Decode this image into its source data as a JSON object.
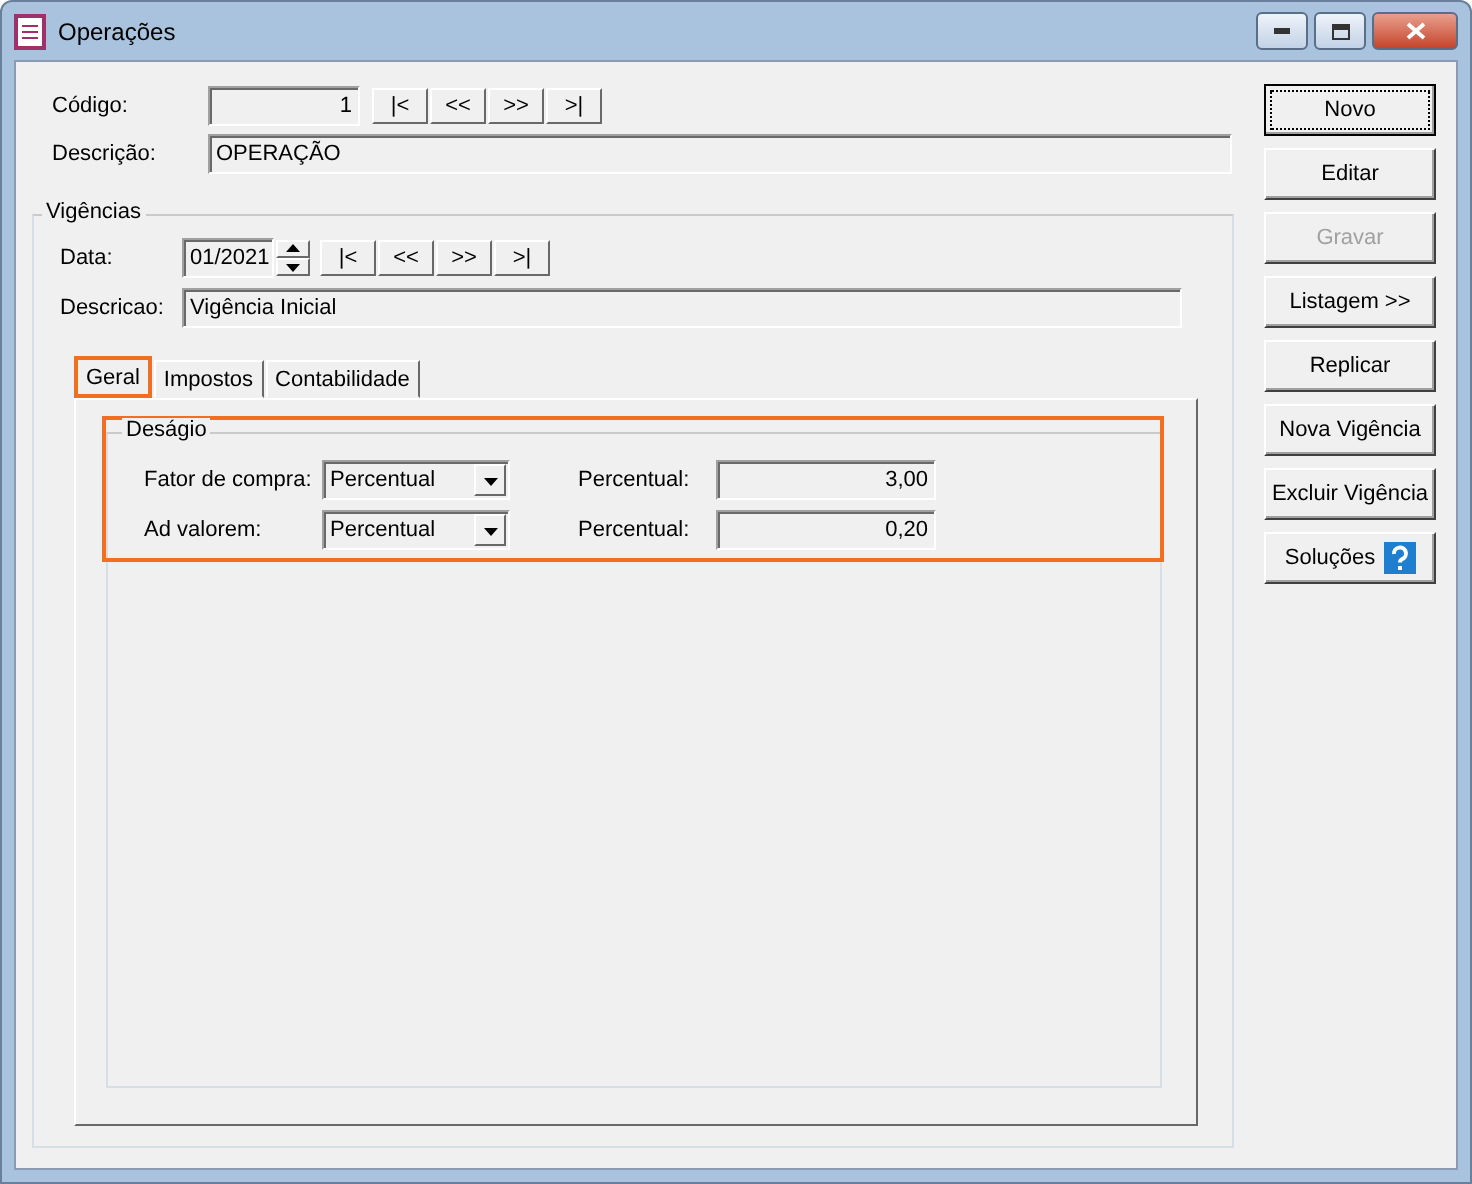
{
  "window": {
    "title": "Operações"
  },
  "codigo": {
    "label": "Código:",
    "value": "1"
  },
  "nav": [
    "|<",
    "<<",
    ">>",
    ">|"
  ],
  "descricao": {
    "label": "Descrição:",
    "value": "OPERAÇÃO"
  },
  "vigencias": {
    "title": "Vigências",
    "data_label": "Data:",
    "data_value": "01/2021",
    "nav": [
      "|<",
      "<<",
      ">>",
      ">|"
    ],
    "descricao_label": "Descricao:",
    "descricao_value": "Vigência Inicial"
  },
  "tabs": [
    {
      "label": "Geral",
      "selected": true,
      "highlighted": true
    },
    {
      "label": "Impostos",
      "selected": false,
      "highlighted": false
    },
    {
      "label": "Contabilidade",
      "selected": false,
      "highlighted": false
    }
  ],
  "desagio": {
    "title": "Deságio",
    "highlighted": true,
    "rows": [
      {
        "label": "Fator de compra:",
        "option": "Percentual",
        "value_label": "Percentual:",
        "value": "3,00"
      },
      {
        "label": "Ad valorem:",
        "option": "Percentual",
        "value_label": "Percentual:",
        "value": "0,20"
      }
    ]
  },
  "buttons": [
    {
      "label": "Novo",
      "disabled": false,
      "focused": true
    },
    {
      "label": "Editar",
      "disabled": false,
      "focused": false
    },
    {
      "label": "Gravar",
      "disabled": true,
      "focused": false
    },
    {
      "label": "Listagem >>",
      "disabled": false,
      "focused": false
    },
    {
      "label": "Replicar",
      "disabled": false,
      "focused": false
    },
    {
      "label": "Nova Vigência",
      "disabled": false,
      "focused": false
    },
    {
      "label": "Excluir Vigência",
      "disabled": false,
      "focused": false
    },
    {
      "label": "Soluções",
      "disabled": false,
      "focused": false,
      "kind": "help"
    }
  ]
}
